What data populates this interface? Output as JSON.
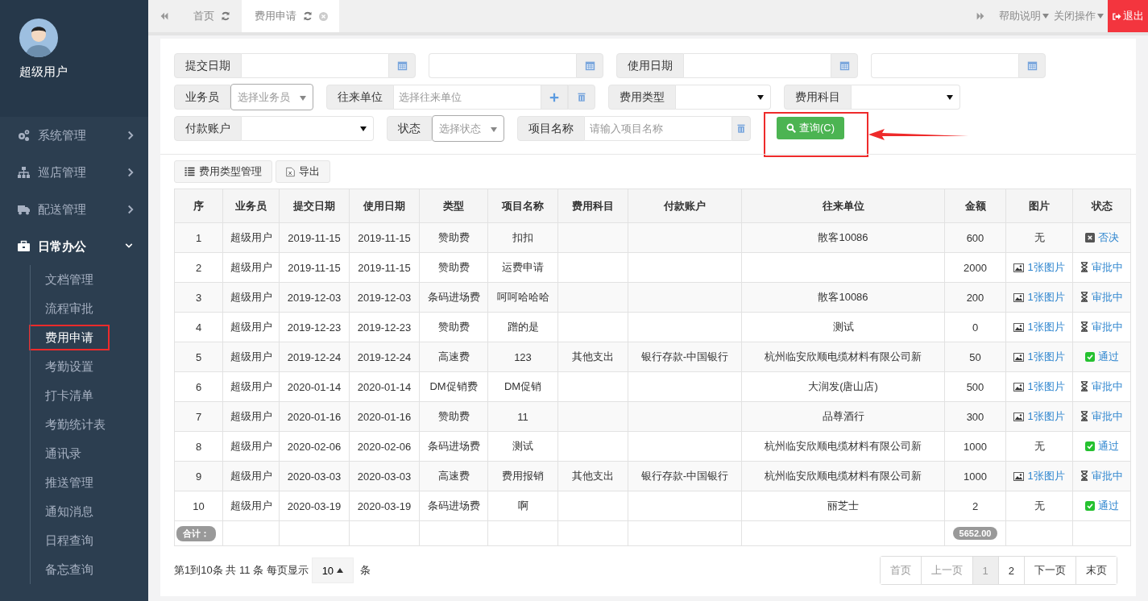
{
  "sidebar": {
    "user": {
      "name": "超级用户"
    },
    "menu": [
      {
        "label": "系统管理",
        "expanded": false
      },
      {
        "label": "巡店管理",
        "expanded": false
      },
      {
        "label": "配送管理",
        "expanded": false
      },
      {
        "label": "日常办公",
        "expanded": true,
        "children": [
          {
            "label": "文档管理",
            "selected": false
          },
          {
            "label": "流程审批",
            "selected": false
          },
          {
            "label": "费用申请",
            "selected": true
          },
          {
            "label": "考勤设置",
            "selected": false
          },
          {
            "label": "打卡清单",
            "selected": false
          },
          {
            "label": "考勤统计表",
            "selected": false
          },
          {
            "label": "通讯录",
            "selected": false
          },
          {
            "label": "推送管理",
            "selected": false
          },
          {
            "label": "通知消息",
            "selected": false
          },
          {
            "label": "日程查询",
            "selected": false
          },
          {
            "label": "备忘查询",
            "selected": false
          }
        ]
      }
    ]
  },
  "tabs": [
    {
      "label": "首页",
      "selected": false,
      "closable": false
    },
    {
      "label": "费用申请",
      "selected": true,
      "closable": true
    }
  ],
  "top_menu": [
    {
      "label": "帮助说明",
      "kind": "dropdown"
    },
    {
      "label": "关闭操作",
      "kind": "dropdown"
    },
    {
      "label": "退出",
      "kind": "logout"
    }
  ],
  "filters": [
    [
      {
        "kind": "date",
        "label": "提交日期"
      },
      {
        "kind": "date"
      },
      {
        "kind": "date",
        "label": "使用日期"
      },
      {
        "kind": "date"
      }
    ],
    [
      {
        "kind": "combo",
        "label": "业务员",
        "placeholder": "选择业务员"
      },
      {
        "kind": "picker",
        "label": "往来单位",
        "placeholder": "选择往来单位"
      },
      {
        "kind": "select",
        "label": "费用类型"
      },
      {
        "kind": "select",
        "label": "费用科目"
      }
    ],
    [
      {
        "kind": "select",
        "label": "付款账户"
      },
      {
        "kind": "combo",
        "label": "状态",
        "placeholder": "选择状态"
      },
      {
        "kind": "search",
        "label": "项目名称",
        "placeholder": "请输入项目名称"
      }
    ]
  ],
  "query_button": {
    "label": "查询(C)",
    "highlighted": true
  },
  "toolbar": [
    {
      "label": "费用类型管理",
      "kind": "list"
    },
    {
      "label": "导出",
      "kind": "export"
    }
  ],
  "table": {
    "columns": [
      "序",
      "业务员",
      "提交日期",
      "使用日期",
      "类型",
      "项目名称",
      "费用科目",
      "付款账户",
      "往来单位",
      "金额",
      "图片",
      "状态"
    ],
    "rows": [
      {
        "cells": [
          "1",
          "超级用户",
          "2019-11-15",
          "2019-11-15",
          "赞助费",
          "扣扣",
          "",
          "",
          "散客10086",
          "600"
        ],
        "image": {
          "kind": "none",
          "text": "无"
        },
        "status": {
          "kind": "rejected",
          "text": "否决"
        }
      },
      {
        "cells": [
          "2",
          "超级用户",
          "2019-11-15",
          "2019-11-15",
          "赞助费",
          "运费申请",
          "",
          "",
          "",
          "2000"
        ],
        "image": {
          "kind": "link",
          "text": "1张图片"
        },
        "status": {
          "kind": "pending",
          "text": "审批中"
        }
      },
      {
        "cells": [
          "3",
          "超级用户",
          "2019-12-03",
          "2019-12-03",
          "条码进场费",
          "呵呵哈哈哈",
          "",
          "",
          "散客10086",
          "200"
        ],
        "image": {
          "kind": "link",
          "text": "1张图片"
        },
        "status": {
          "kind": "pending",
          "text": "审批中"
        }
      },
      {
        "cells": [
          "4",
          "超级用户",
          "2019-12-23",
          "2019-12-23",
          "赞助费",
          "蹭的是",
          "",
          "",
          "测试",
          "0"
        ],
        "image": {
          "kind": "link",
          "text": "1张图片"
        },
        "status": {
          "kind": "pending",
          "text": "审批中"
        }
      },
      {
        "cells": [
          "5",
          "超级用户",
          "2019-12-24",
          "2019-12-24",
          "高速费",
          "123",
          "其他支出",
          "银行存款-中国银行",
          "杭州临安欣顺电缆材料有限公司新",
          "50"
        ],
        "image": {
          "kind": "link",
          "text": "1张图片"
        },
        "status": {
          "kind": "approved",
          "text": "通过"
        }
      },
      {
        "cells": [
          "6",
          "超级用户",
          "2020-01-14",
          "2020-01-14",
          "DM促销费",
          "DM促销",
          "",
          "",
          "大润发(唐山店)",
          "500"
        ],
        "image": {
          "kind": "link",
          "text": "1张图片"
        },
        "status": {
          "kind": "pending",
          "text": "审批中"
        }
      },
      {
        "cells": [
          "7",
          "超级用户",
          "2020-01-16",
          "2020-01-16",
          "赞助费",
          "11",
          "",
          "",
          "品尊酒行",
          "300"
        ],
        "image": {
          "kind": "link",
          "text": "1张图片"
        },
        "status": {
          "kind": "pending",
          "text": "审批中"
        }
      },
      {
        "cells": [
          "8",
          "超级用户",
          "2020-02-06",
          "2020-02-06",
          "条码进场费",
          "测试",
          "",
          "",
          "杭州临安欣顺电缆材料有限公司新",
          "1000"
        ],
        "image": {
          "kind": "none",
          "text": "无"
        },
        "status": {
          "kind": "approved",
          "text": "通过"
        }
      },
      {
        "cells": [
          "9",
          "超级用户",
          "2020-03-03",
          "2020-03-03",
          "高速费",
          "费用报销",
          "其他支出",
          "银行存款-中国银行",
          "杭州临安欣顺电缆材料有限公司新",
          "1000"
        ],
        "image": {
          "kind": "link",
          "text": "1张图片"
        },
        "status": {
          "kind": "pending",
          "text": "审批中"
        }
      },
      {
        "cells": [
          "10",
          "超级用户",
          "2020-03-19",
          "2020-03-19",
          "条码进场费",
          "啊",
          "",
          "",
          "丽芝士",
          "2"
        ],
        "image": {
          "kind": "none",
          "text": "无"
        },
        "status": {
          "kind": "approved",
          "text": "通过"
        }
      }
    ],
    "footer": {
      "label": "合计：",
      "total": "5652.00"
    }
  },
  "pagination": {
    "summary": "第1到10条 共 11 条 每页显示",
    "page_size": "10",
    "unit": "条",
    "pages": [
      {
        "label": "首页",
        "disabled": true,
        "selected": false
      },
      {
        "label": "上一页",
        "disabled": true,
        "selected": false
      },
      {
        "label": "1",
        "disabled": false,
        "selected": true
      },
      {
        "label": "2",
        "disabled": false,
        "selected": false
      },
      {
        "label": "下一页",
        "disabled": false,
        "selected": false
      },
      {
        "label": "末页",
        "disabled": false,
        "selected": false
      }
    ]
  }
}
